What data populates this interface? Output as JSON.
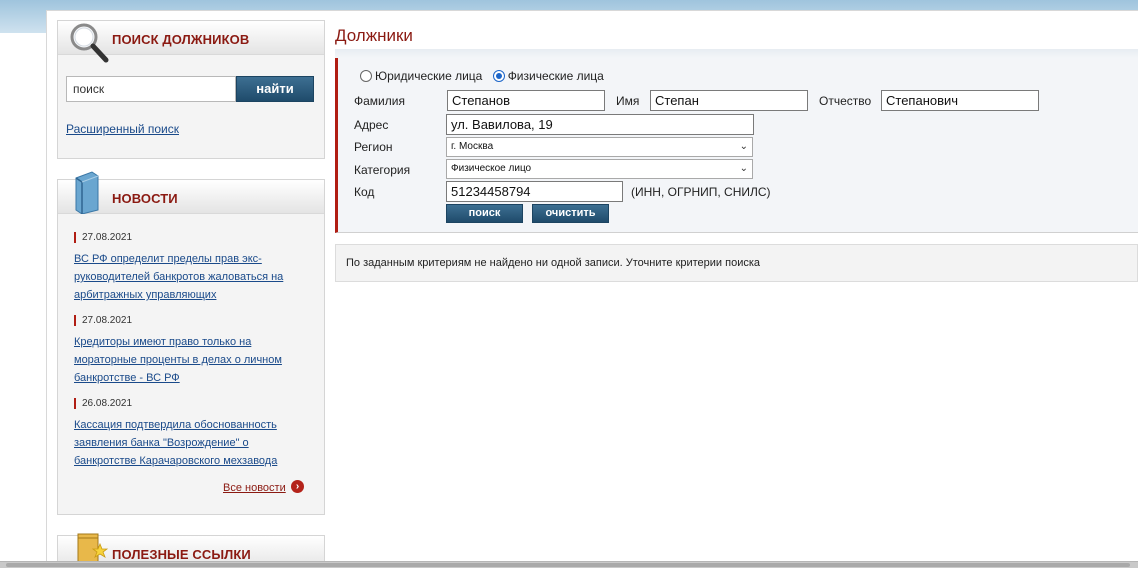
{
  "sidebar": {
    "search": {
      "title": "Поиск должников",
      "input_value": "поиск",
      "find_button": "найти",
      "advanced_link": "Расширенный поиск"
    },
    "news": {
      "title": "Новости",
      "items": [
        {
          "date": "27.08.2021",
          "text": "ВС РФ определит пределы прав экс-руководителей банкротов жаловаться на арбитражных управляющих"
        },
        {
          "date": "27.08.2021",
          "text": "Кредиторы имеют право только на мораторные проценты в делах о личном банкротстве - ВС РФ"
        },
        {
          "date": "26.08.2021",
          "text": "Кассация подтвердила обоснованность заявления банка \"Возрождение\" о банкротстве Карачаровского мехзавода"
        }
      ],
      "all_news": "Все новости"
    },
    "links": {
      "title": "Полезные ссылки"
    }
  },
  "main": {
    "title": "Должники",
    "form": {
      "radio_legal": "Юридические лица",
      "radio_person": "Физические лица",
      "selected_type": "Физические лица",
      "surname_label": "Фамилия",
      "surname_value": "Степанов",
      "name_label": "Имя",
      "name_value": "Степан",
      "patronymic_label": "Отчество",
      "patronymic_value": "Степанович",
      "address_label": "Адрес",
      "address_value": "ул. Вавилова, 19",
      "region_label": "Регион",
      "region_value": "г. Москва",
      "category_label": "Категория",
      "category_value": "Физическое лицо",
      "code_label": "Код",
      "code_value": "51234458794",
      "code_hint": "(ИНН, ОГРНИП, СНИЛС)",
      "search_button": "поиск",
      "clear_button": "очистить"
    },
    "result_message": "По заданным критериям не найдено ни одной записи. Уточните критерии поиска"
  },
  "colors": {
    "accent_red": "#8b1a12",
    "button_blue": "#1f4b6b",
    "link_blue": "#1a4a8a"
  }
}
